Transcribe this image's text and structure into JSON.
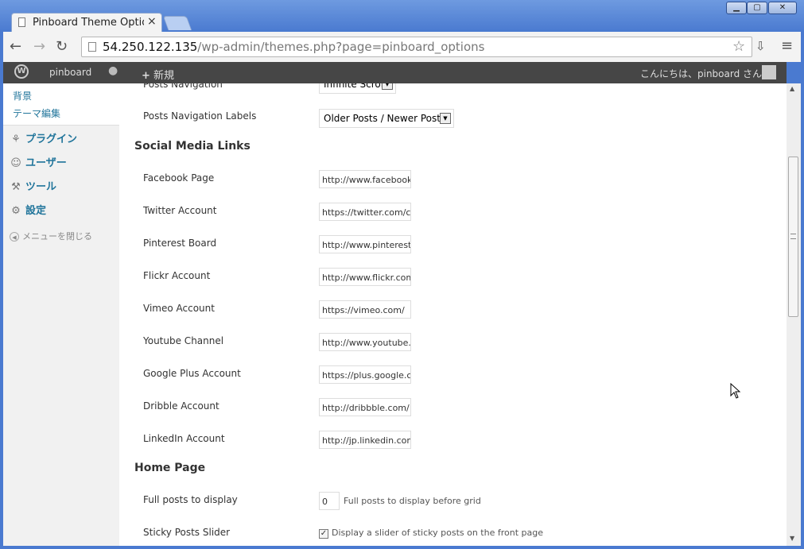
{
  "browser": {
    "tab_title": "Pinboard Theme Option",
    "url_host": "54.250.122.135",
    "url_path": "/wp-admin/themes.php?page=pinboard_options",
    "window_controls": [
      "minimize",
      "maximize",
      "close"
    ]
  },
  "adminbar": {
    "site_name": "pinboard",
    "new_label": "新規",
    "greeting": "こんにちは、pinboard さん！"
  },
  "sidebar": {
    "submenu": [
      "背景",
      "テーマ編集"
    ],
    "menu": [
      {
        "label": "プラグイン",
        "icon": "plugin-icon"
      },
      {
        "label": "ユーザー",
        "icon": "users-icon"
      },
      {
        "label": "ツール",
        "icon": "tools-icon"
      },
      {
        "label": "設定",
        "icon": "settings-icon"
      }
    ],
    "collapse_label": "メニューを閉じる"
  },
  "main": {
    "top_partial": {
      "label": "Posts Navigation",
      "value": "Infinite Scroll"
    },
    "nav_labels": {
      "label": "Posts Navigation Labels",
      "value": "Older Posts / Newer Posts"
    },
    "social_heading": "Social Media Links",
    "social": [
      {
        "label": "Facebook Page",
        "value": "http://www.facebook."
      },
      {
        "label": "Twitter Account",
        "value": "https://twitter.com/c"
      },
      {
        "label": "Pinterest Board",
        "value": "http://www.pinterest."
      },
      {
        "label": "Flickr Account",
        "value": "http://www.flickr.com"
      },
      {
        "label": "Vimeo Account",
        "value": "https://vimeo.com/"
      },
      {
        "label": "Youtube Channel",
        "value": "http://www.youtube.c"
      },
      {
        "label": "Google Plus Account",
        "value": "https://plus.google.cc"
      },
      {
        "label": "Dribble Account",
        "value": "http://dribbble.com/"
      },
      {
        "label": "LinkedIn Account",
        "value": "http://jp.linkedin.com."
      }
    ],
    "home_heading": "Home Page",
    "full_posts": {
      "label": "Full posts to display",
      "value": "0",
      "desc": "Full posts to display before grid"
    },
    "sticky": {
      "label": "Sticky Posts Slider",
      "checked": true,
      "desc": "Display a slider of sticky posts on the front page"
    }
  }
}
